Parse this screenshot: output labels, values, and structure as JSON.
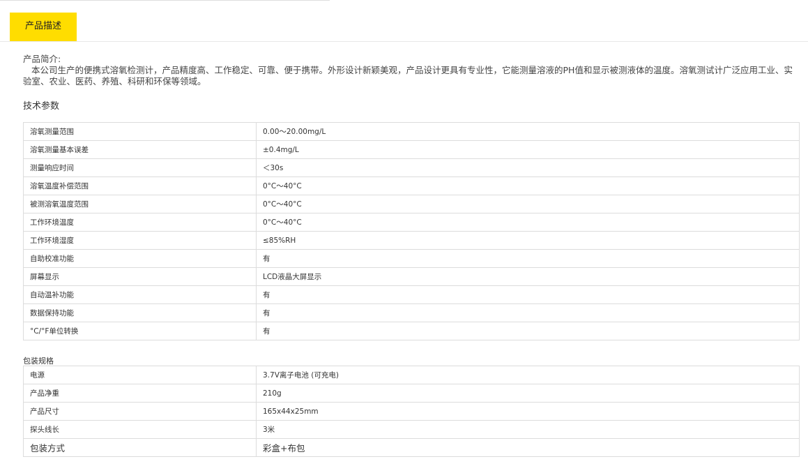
{
  "tabs": {
    "active": "产品描述"
  },
  "intro": {
    "heading": "产品简介:",
    "text": "本公司生产的便携式溶氧检测计，产品精度高、工作稳定、可靠、便于携带。外形设计新颖美观，产品设计更具有专业性，它能测量溶液的PH值和显示被测液体的温度。溶氧测试计广泛应用工业、实验室、农业、医药、养殖、科研和环保等领域。"
  },
  "specs": {
    "title": "技术参数",
    "rows": [
      {
        "label": "溶氧测量范围",
        "value": "0.00～20.00mg/L"
      },
      {
        "label": "溶氧测量基本误差",
        "value": "±0.4mg/L"
      },
      {
        "label": "测量响应时间",
        "value": "＜30s"
      },
      {
        "label": "溶氧温度补偿范围",
        "value": "0°C～40°C"
      },
      {
        "label": "被测溶氧温度范围",
        "value": "0°C～40°C"
      },
      {
        "label": "工作环境温度",
        "value": "0°C～40°C"
      },
      {
        "label": "工作环境湿度",
        "value": "≤85%RH"
      },
      {
        "label": "自助校准功能",
        "value": "有"
      },
      {
        "label": "屏幕显示",
        "value": "LCD液晶大屏显示"
      },
      {
        "label": "自动温补功能",
        "value": "有"
      },
      {
        "label": "数据保持功能",
        "value": "有"
      },
      {
        "label": "°C/°F单位转换",
        "value": "有"
      }
    ]
  },
  "packaging": {
    "title": "包装规格",
    "rows": [
      {
        "label": "电源",
        "value": "3.7V离子电池 (可充电)"
      },
      {
        "label": "产品净重",
        "value": "210g"
      },
      {
        "label": "产品尺寸",
        "value": "165x44x25mm"
      },
      {
        "label": "探头线长",
        "value": "3米"
      },
      {
        "label": "包装方式",
        "value": "彩盒+布包"
      }
    ]
  }
}
